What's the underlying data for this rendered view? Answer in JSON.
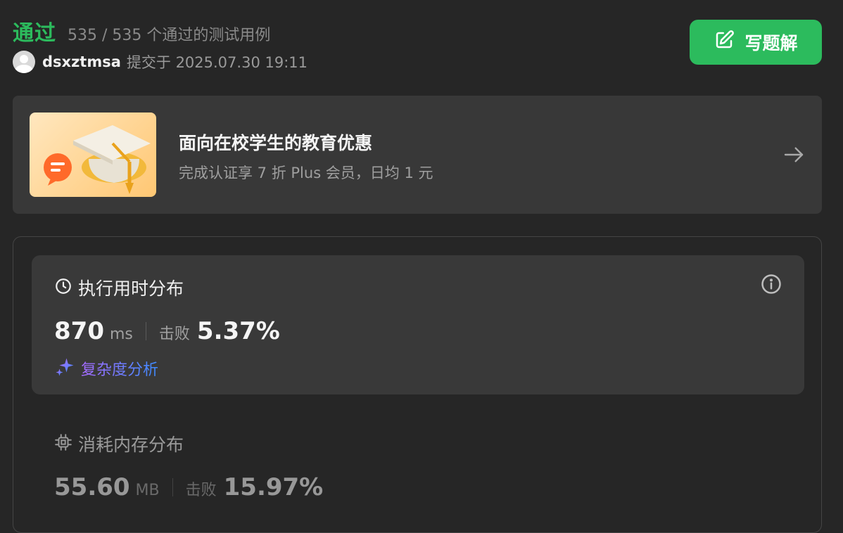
{
  "status": {
    "title": "通过",
    "count": "535 / 535 个通过的测试用例",
    "username": "dsxztmsa",
    "submitted": "提交于 2025.07.30 19:11"
  },
  "solution_button": {
    "label": "写题解",
    "icon": "edit-icon"
  },
  "promo": {
    "title": "面向在校学生的教育优惠",
    "subtitle": "完成认证享 7 折 Plus 会员，日均 1 元",
    "icon": "graduation-cap-icon"
  },
  "runtime": {
    "title": "执行用时分布",
    "value": "870",
    "unit": "ms",
    "beat_label": "击败",
    "beat_value": "5.37%",
    "complexity_label": "复杂度分析"
  },
  "memory": {
    "title": "消耗内存分布",
    "value": "55.60",
    "unit": "MB",
    "beat_label": "击败",
    "beat_value": "15.97%"
  },
  "colors": {
    "accent_green": "#2cbb5d",
    "background": "#262626",
    "card": "#393939"
  }
}
